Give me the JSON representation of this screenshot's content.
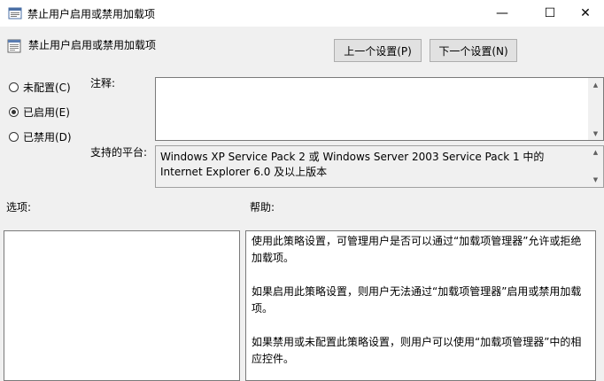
{
  "window": {
    "title": "禁止用户启用或禁用加载项",
    "controls": {
      "minimize": "—",
      "maximize": "☐",
      "close": "✕"
    }
  },
  "header": {
    "title": "禁止用户启用或禁用加载项",
    "prev_button": "上一个设置(P)",
    "next_button": "下一个设置(N)"
  },
  "radios": [
    {
      "label": "未配置(C)",
      "checked": false
    },
    {
      "label": "已启用(E)",
      "checked": true
    },
    {
      "label": "已禁用(D)",
      "checked": false
    }
  ],
  "comment": {
    "label": "注释:",
    "value": ""
  },
  "platform": {
    "label": "支持的平台:",
    "value": "Windows XP Service Pack 2 或 Windows Server 2003 Service Pack 1 中的 Internet Explorer 6.0 及以上版本"
  },
  "options": {
    "label": "选项:"
  },
  "help": {
    "label": "帮助:",
    "paragraphs": [
      "使用此策略设置，可管理用户是否可以通过“加载项管理器”允许或拒绝加载项。",
      "如果启用此策略设置，则用户无法通过“加载项管理器”启用或禁用加载项。",
      "如果禁用或未配置此策略设置，则用户可以使用“加载项管理器”中的相应控件。"
    ]
  },
  "icons": {
    "window": "policy-icon",
    "header": "setting-icon"
  },
  "colors": {
    "window_bg": "#f0f0f0",
    "button_bg": "#e1e1e1",
    "border": "#7a7a7a"
  }
}
